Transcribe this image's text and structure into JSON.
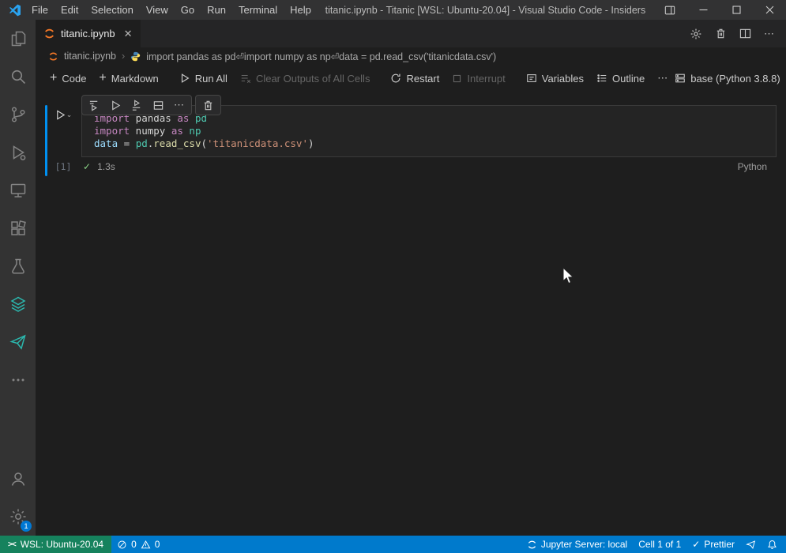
{
  "colors": {
    "accent": "#007acc",
    "remote_bg": "#16825d",
    "jupyter_orange": "#f37726"
  },
  "title_bar": {
    "menus": [
      "File",
      "Edit",
      "Selection",
      "View",
      "Go",
      "Run",
      "Terminal",
      "Help"
    ],
    "title": "titanic.ipynb - Titanic [WSL: Ubuntu-20.04] - Visual Studio Code - Insiders"
  },
  "tab_bar": {
    "tab": "titanic.ipynb"
  },
  "breadcrumb": {
    "file": "titanic.ipynb",
    "cell_preview": "import pandas as pd⏎import numpy as np⏎data = pd.read_csv('titanicdata.csv')"
  },
  "notebook_toolbar": {
    "add_code": "Code",
    "add_markdown": "Markdown",
    "run_all": "Run All",
    "clear_outputs": "Clear Outputs of All Cells",
    "restart": "Restart",
    "interrupt": "Interrupt",
    "variables": "Variables",
    "outline": "Outline",
    "kernel": "base (Python 3.8.8)"
  },
  "cell": {
    "execution_count": "[1]",
    "code_lines": [
      [
        [
          "kw",
          "import"
        ],
        [
          "plain",
          " pandas "
        ],
        [
          "kw",
          "as"
        ],
        [
          "type",
          " pd"
        ]
      ],
      [
        [
          "kw",
          "import"
        ],
        [
          "plain",
          " numpy "
        ],
        [
          "kw",
          "as"
        ],
        [
          "type",
          " np"
        ]
      ],
      [
        [
          "var",
          "data"
        ],
        [
          "plain",
          " = "
        ],
        [
          "type",
          "pd"
        ],
        [
          "plain",
          "."
        ],
        [
          "fn",
          "read_csv"
        ],
        [
          "plain",
          "("
        ],
        [
          "str",
          "'titanicdata.csv'"
        ],
        [
          "plain",
          ")"
        ]
      ]
    ],
    "duration": "1.3s",
    "language": "Python"
  },
  "status_bar": {
    "remote": "WSL: Ubuntu-20.04",
    "errors": "0",
    "warnings": "0",
    "jupyter_server": "Jupyter Server: local",
    "cell_position": "Cell 1 of 1",
    "formatter": "Prettier",
    "settings_badge": "1"
  }
}
